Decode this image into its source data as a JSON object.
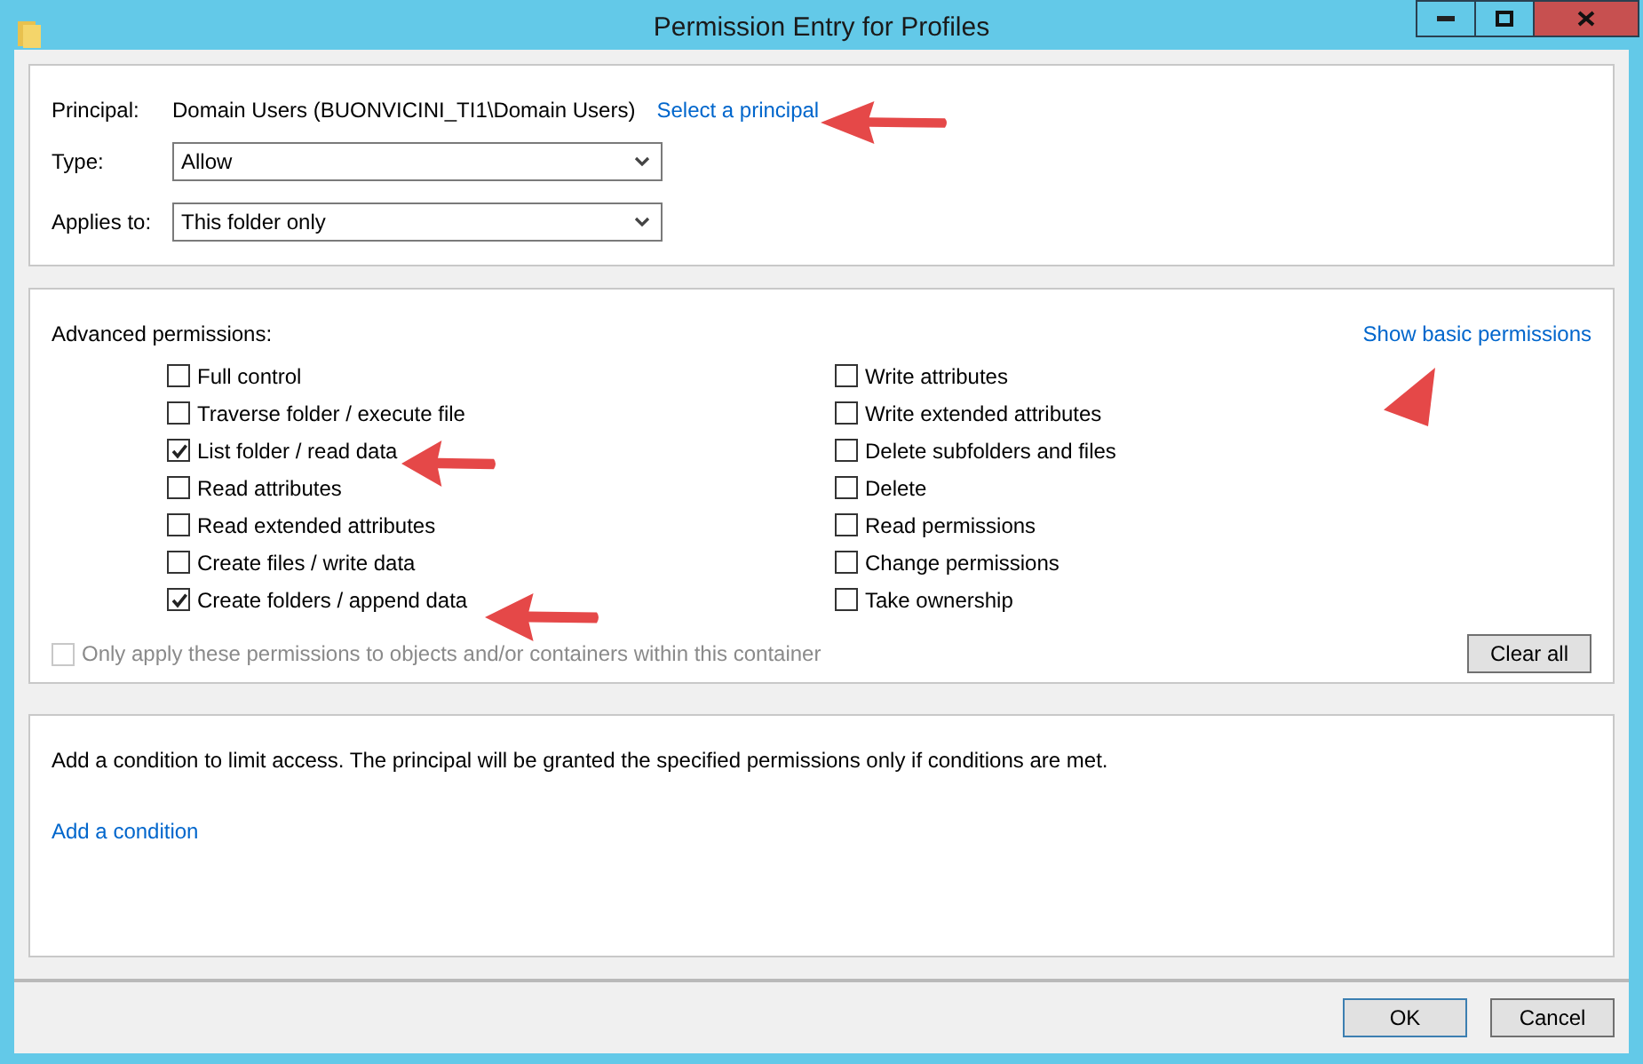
{
  "window": {
    "title": "Permission Entry for Profiles"
  },
  "principal": {
    "label": "Principal:",
    "value": "Domain Users (BUONVICINI_TI1\\Domain Users)",
    "link": "Select a principal"
  },
  "fields": [
    {
      "label": "Type:",
      "value": "Allow"
    },
    {
      "label": "Applies to:",
      "value": "This folder only"
    }
  ],
  "permissions": {
    "heading": "Advanced permissions:",
    "toggle_link": "Show basic permissions",
    "columns": [
      [
        {
          "label": "Full control",
          "checked": false
        },
        {
          "label": "Traverse folder / execute file",
          "checked": false
        },
        {
          "label": "List folder / read data",
          "checked": true
        },
        {
          "label": "Read attributes",
          "checked": false
        },
        {
          "label": "Read extended attributes",
          "checked": false
        },
        {
          "label": "Create files / write data",
          "checked": false
        },
        {
          "label": "Create folders / append data",
          "checked": true
        }
      ],
      [
        {
          "label": "Write attributes",
          "checked": false
        },
        {
          "label": "Write extended attributes",
          "checked": false
        },
        {
          "label": "Delete subfolders and files",
          "checked": false
        },
        {
          "label": "Delete",
          "checked": false
        },
        {
          "label": "Read permissions",
          "checked": false
        },
        {
          "label": "Change permissions",
          "checked": false
        },
        {
          "label": "Take ownership",
          "checked": false
        }
      ]
    ],
    "apply_only": {
      "label": "Only apply these permissions to objects and/or containers within this container",
      "checked": false,
      "disabled": true
    },
    "clear_button": "Clear all"
  },
  "condition": {
    "text": "Add a condition to limit access. The principal will be granted the specified permissions only if conditions are met.",
    "link": "Add a condition"
  },
  "buttons": [
    {
      "label": "OK",
      "default": true
    },
    {
      "label": "Cancel",
      "default": false
    }
  ]
}
